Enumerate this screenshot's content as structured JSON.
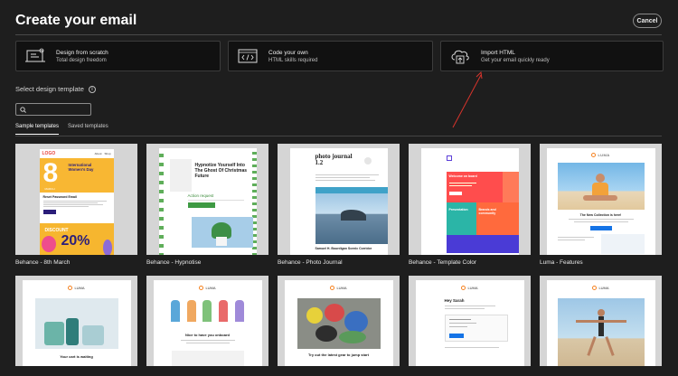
{
  "header": {
    "title": "Create your email",
    "cancel_label": "Cancel"
  },
  "options": [
    {
      "title": "Design from scratch",
      "subtitle": "Total design freedom",
      "icon": "design-canvas-icon"
    },
    {
      "title": "Code your own",
      "subtitle": "HTML skills required",
      "icon": "code-editor-icon"
    },
    {
      "title": "Import HTML",
      "subtitle": "Get your email quickly ready",
      "icon": "cloud-upload-icon"
    }
  ],
  "section": {
    "title": "Select design template",
    "info_icon": "info-icon"
  },
  "search": {
    "placeholder": "",
    "value": "",
    "icon": "search-icon"
  },
  "tabs": [
    {
      "label": "Sample templates",
      "active": true
    },
    {
      "label": "Saved templates",
      "active": false
    }
  ],
  "templates": [
    {
      "label": "Behance - 8th March",
      "content": {
        "logo": "LOGO",
        "nav": [
          "About",
          "Shop"
        ],
        "number": "8",
        "month": "MARCH",
        "headline": "International Women's Day",
        "reset": "Reset Password Email",
        "discount": "DISCOUNT",
        "percent": "20%"
      }
    },
    {
      "label": "Behance - Hypnotise",
      "content": {
        "headline": "Hypnotize Yourself Into The Ghost Of Christmas Future",
        "action": "Action request"
      }
    },
    {
      "label": "Behance - Photo Journal",
      "content": {
        "title": "photo journal 1.2",
        "caption": "Samuel H. Bourdigan Scenic Corridor"
      }
    },
    {
      "label": "Behance - Template Color",
      "content": {
        "welcome": "Welcome on board",
        "presentation": "Presentation",
        "brands": "Brands and community"
      }
    },
    {
      "label": "Luma - Features",
      "content": {
        "brand": "LUMA",
        "collection": "The New Collection is here!"
      }
    },
    {
      "label": "",
      "content": {
        "brand": "LUMA",
        "caption": "Your cart is waiting"
      }
    },
    {
      "label": "",
      "content": {
        "brand": "LUMA",
        "caption": "Nice to have you onboard"
      }
    },
    {
      "label": "",
      "content": {
        "brand": "LUMA",
        "caption": "Try out the latest gear to jump start"
      }
    },
    {
      "label": "",
      "content": {
        "brand": "LUMA",
        "heading": "Hey Sarah"
      }
    },
    {
      "label": "",
      "content": {
        "brand": "LUMA"
      }
    }
  ],
  "colors": {
    "background": "#1e1e1e",
    "card": "#111111",
    "annotation_arrow": "#d8342c",
    "luma_orange": "#f58220",
    "luma_blue": "#1473e6"
  }
}
